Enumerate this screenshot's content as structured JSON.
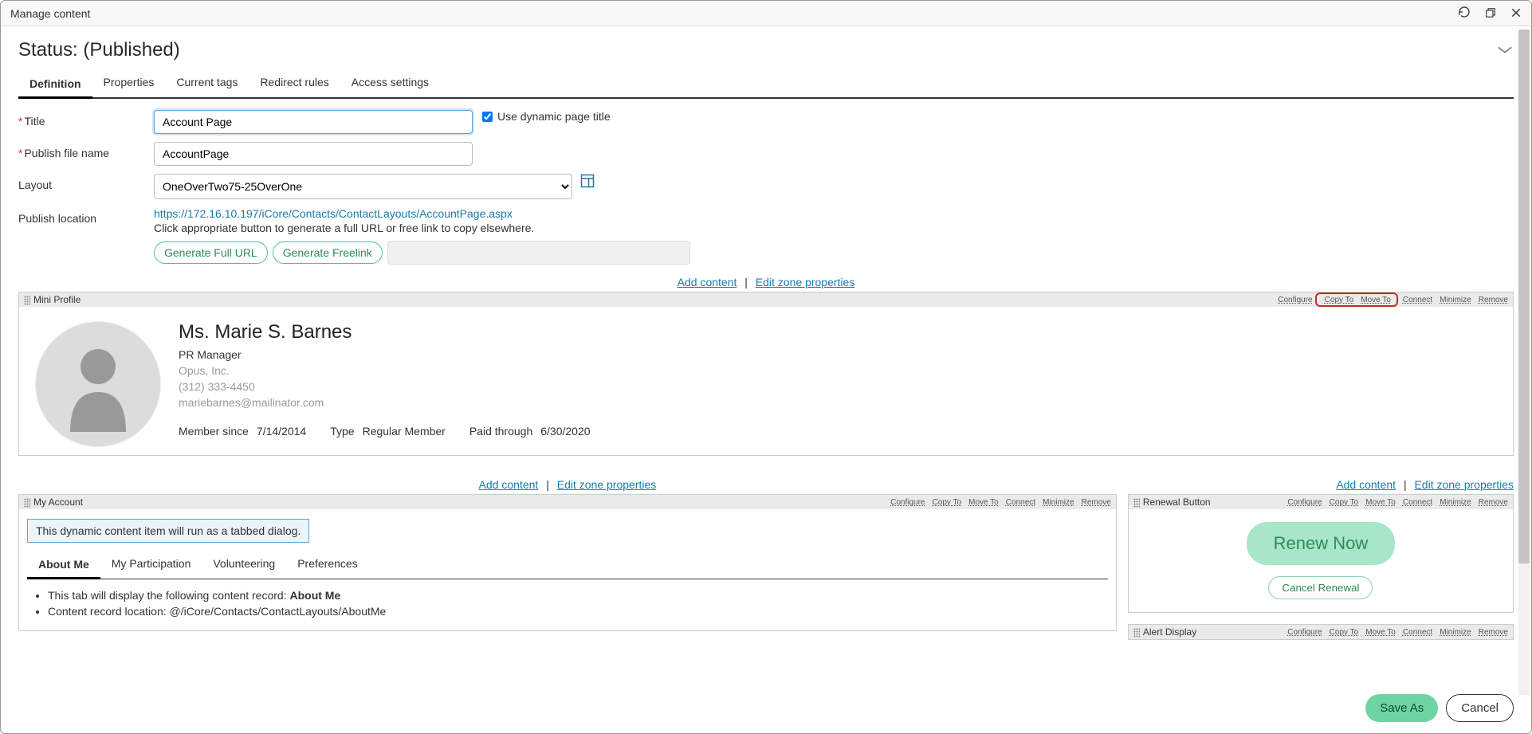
{
  "window": {
    "title": "Manage content"
  },
  "status": {
    "label": "Status: (Published)"
  },
  "tabs": [
    "Definition",
    "Properties",
    "Current tags",
    "Redirect rules",
    "Access settings"
  ],
  "form": {
    "title_label": "Title",
    "title_value": "Account Page",
    "dyn_title_label": "Use dynamic page title",
    "dyn_title_checked": true,
    "pubfile_label": "Publish file name",
    "pubfile_value": "AccountPage",
    "layout_label": "Layout",
    "layout_value": "OneOverTwo75-25OverOne",
    "publoc_label": "Publish location",
    "publoc_url": "https://172.16.10.197/iCore/Contacts/ContactLayouts/AccountPage.aspx",
    "publoc_hint": "Click appropriate button to generate a full URL or free link to copy elsewhere.",
    "gen_full_url": "Generate Full URL",
    "gen_freelink": "Generate Freelink"
  },
  "zone_links": {
    "add": "Add content",
    "edit": "Edit zone properties"
  },
  "panel_actions": {
    "configure": "Configure",
    "copy": "Copy To",
    "move": "Move To",
    "connect": "Connect",
    "minimize": "Minimize",
    "remove": "Remove"
  },
  "mini_profile": {
    "panel_title": "Mini Profile",
    "name": "Ms. Marie S. Barnes",
    "role": "PR Manager",
    "company": "Opus, Inc.",
    "phone": "(312) 333-4450",
    "email": "mariebarnes@mailinator.com",
    "member_since_k": "Member since",
    "member_since_v": "7/14/2014",
    "type_k": "Type",
    "type_v": "Regular Member",
    "paid_k": "Paid through",
    "paid_v": "6/30/2020"
  },
  "my_account": {
    "panel_title": "My Account",
    "banner": "This dynamic content item will run as a tabbed dialog.",
    "sub_tabs": [
      "About Me",
      "My Participation",
      "Volunteering",
      "Preferences"
    ],
    "line1a": "This tab will display the following content record: ",
    "line1b": "About Me",
    "line2a": "Content record location: ",
    "line2b": "@/iCore/Contacts/ContactLayouts/AboutMe"
  },
  "renewal": {
    "panel_title": "Renewal Button",
    "renew": "Renew Now",
    "cancel": "Cancel Renewal"
  },
  "alert": {
    "panel_title": "Alert Display"
  },
  "footer": {
    "save": "Save As",
    "cancel": "Cancel"
  }
}
